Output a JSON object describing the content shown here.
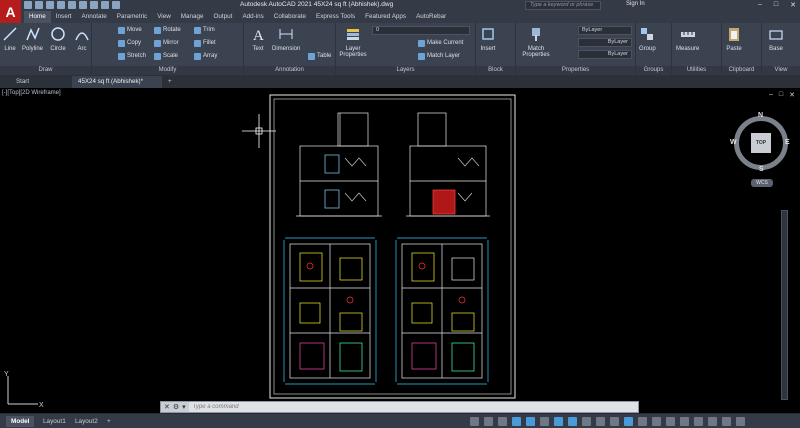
{
  "app": {
    "logo": "A",
    "title": "Autodesk AutoCAD 2021    45X24 sq ft (Abhishek).dwg",
    "search_placeholder": "Type a keyword or phrase",
    "sign_in": "Sign In",
    "help": "?"
  },
  "ribbon_tabs": [
    "Home",
    "Insert",
    "Annotate",
    "Parametric",
    "View",
    "Manage",
    "Output",
    "Add-ins",
    "Collaborate",
    "Express Tools",
    "Featured Apps",
    "AutoRebar"
  ],
  "panels": {
    "draw": {
      "title": "Draw",
      "tools": [
        "Line",
        "Polyline",
        "Circle",
        "Arc"
      ]
    },
    "modify": {
      "title": "Modify",
      "tools": [
        "Move",
        "Rotate",
        "Trim",
        "Copy",
        "Mirror",
        "Fillet",
        "Stretch",
        "Scale",
        "Array"
      ]
    },
    "annotation": {
      "title": "Annotation",
      "tools": [
        "Text",
        "Dimension",
        "Table"
      ]
    },
    "layers": {
      "title": "Layers",
      "tools": [
        "Layer Properties",
        "Make Current",
        "Match Layer"
      ],
      "current_layer": "0"
    },
    "block": {
      "title": "Block",
      "tools": [
        "Insert"
      ]
    },
    "properties": {
      "title": "Properties",
      "tools": [
        "Match Properties"
      ],
      "color": "ByLayer",
      "linetype": "ByLayer",
      "lineweight": "ByLayer"
    },
    "groups": {
      "title": "Groups",
      "tools": [
        "Group"
      ]
    },
    "utilities": {
      "title": "Utilities",
      "tools": [
        "Measure"
      ]
    },
    "clipboard": {
      "title": "Clipboard",
      "tools": [
        "Paste"
      ]
    },
    "view": {
      "title": "View",
      "tools": [
        "Base"
      ]
    }
  },
  "file_tabs": {
    "start": "Start",
    "document": "45X24 sq ft (Abhishek)*",
    "new": "+"
  },
  "viewport": {
    "label": "[-][Top][2D Wireframe]"
  },
  "viewcube": {
    "face": "TOP",
    "north": "N",
    "south": "S",
    "east": "E",
    "west": "W",
    "wcs": "WCS"
  },
  "command_line": {
    "placeholder": "Type a command"
  },
  "layout_tabs": [
    "Model",
    "Layout1",
    "Layout2",
    "+"
  ],
  "colors": {
    "accent": "#4a9ad8",
    "ribbon": "#3b4250",
    "titlebar": "#353b46",
    "logo": "#b71c1c"
  }
}
